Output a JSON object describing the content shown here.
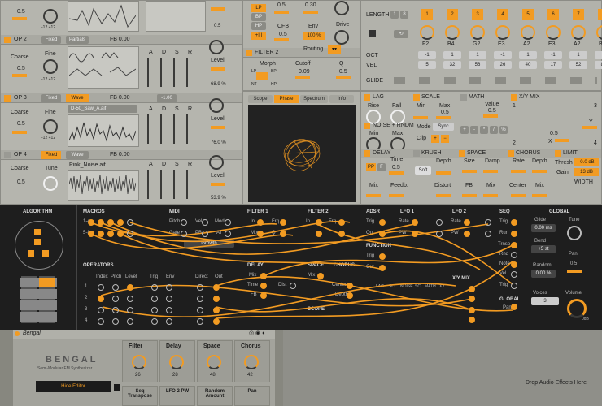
{
  "operators": [
    {
      "name": "",
      "mode": "",
      "waveform": "",
      "values": {
        "top_a": "0.5",
        "fine_range": "-12  +12"
      },
      "level_label": ""
    },
    {
      "name": "OP 2",
      "mode": "Fixed",
      "waveform": "Partials",
      "fb": "FB  0.00",
      "coarse": "Coarse",
      "fine": "Fine",
      "range": "-12  +12",
      "coarse_val": "0.5",
      "level": "Level",
      "level_val": "68.9 %",
      "adsr": [
        "A",
        "D",
        "S",
        "R"
      ]
    },
    {
      "name": "OP 3",
      "mode": "Fixed",
      "waveform": "Wave",
      "fb": "FB  0.00",
      "file": "D-50_Saw_A.aif",
      "coarse": "Coarse",
      "fine": "Fine",
      "range": "-12  +12",
      "coarse_val": "0.5",
      "level": "Level",
      "level_val": "76.0 %",
      "adsr": [
        "A",
        "D",
        "S",
        "R"
      ],
      "loop": "-1.00"
    },
    {
      "name": "OP 4",
      "mode": "Fixed",
      "waveform": "Wave",
      "fb": "FB  0.00",
      "file": "Pink_Noise.aif",
      "coarse": "Coarse",
      "tune": "Tune",
      "coarse_val": "0.5",
      "level": "Level",
      "level_val": "53.9 %",
      "adsr": [
        "A",
        "D",
        "S",
        "R"
      ]
    }
  ],
  "top": {
    "val1": "0.5",
    "val2": "0.30",
    "cfb": "CFB",
    "env": "Env",
    "env_val": "100 %",
    "drive": "Drive",
    "lp": "LP",
    "bp": "BP",
    "hp": "HP",
    "cfb_val": "0.5"
  },
  "filter2": {
    "title": "FILTER 2",
    "morph": "Morph",
    "cutoff": "Cutoff",
    "q": "Q",
    "routing": "Routing",
    "cutoff_val": "0.09",
    "q_val": "0.5",
    "mval": "0.5",
    "lp": "LP",
    "bp": "BP",
    "hp": "HP",
    "nt": "NT"
  },
  "scope": {
    "tabs": [
      "Scope",
      "Phase",
      "Spectrum",
      "Info"
    ],
    "active": "Phase"
  },
  "seq": {
    "length_label": "LENGTH",
    "length_a": "1",
    "length_b": "8",
    "steps": [
      "1",
      "2",
      "3",
      "4",
      "5",
      "6",
      "7",
      "8"
    ],
    "notes": [
      "F2",
      "B4",
      "G2",
      "E3",
      "A2",
      "E3",
      "A2",
      "B1"
    ],
    "oct": "OCT",
    "vel": "VEL",
    "glide": "GLIDE",
    "oct_vals": [
      "-1",
      "1",
      "1",
      "-1",
      "1",
      "-1",
      "1",
      "1"
    ],
    "vel_vals": [
      "5",
      "32",
      "56",
      "26",
      "40",
      "17",
      "52",
      "83"
    ]
  },
  "lag": {
    "title": "LAG",
    "rise": "Rise",
    "fall": "Fall",
    "val": "0.5"
  },
  "scale": {
    "title": "SCALE",
    "min": "Min",
    "max": "Max",
    "mode": "Mode",
    "mode_val": "Sync",
    "clip": "Clip",
    "val": "0.5"
  },
  "noise": {
    "title": "NOISE + RNDM",
    "min": "Min",
    "max": "Max"
  },
  "math": {
    "title": "MATH",
    "value": "Value",
    "val": "0.5",
    "ops": [
      "+",
      "-",
      "*",
      "/",
      "%"
    ]
  },
  "xymix": {
    "title": "X/Y MIX",
    "y": "Y",
    "x": "X",
    "nums": [
      "1",
      "2",
      "3",
      "4"
    ],
    "val": "0.5"
  },
  "delay": {
    "title": "DELAY",
    "time": "Time",
    "mix": "Mix",
    "feedb": "Feedb.",
    "pp": "PP",
    "f": "F",
    "val": "0.5"
  },
  "krush": {
    "title": "KRUSH",
    "depth": "Depth",
    "soft": "Soft",
    "distort": "Distort",
    "val": "0.5"
  },
  "space": {
    "title": "SPACE",
    "size": "Size",
    "damp": "Damp",
    "fb": "FB",
    "mix": "Mix",
    "val": "0.5"
  },
  "chorus": {
    "title": "CHORUS",
    "rate": "Rate",
    "depth": "Depth",
    "center": "Center",
    "mix": "Mix",
    "val": "0.5"
  },
  "limit": {
    "title": "LIMIT",
    "thresh": "Thresh",
    "thresh_val": "-0.0 dB",
    "gain": "Gain",
    "gain_val": "13 dB",
    "width": "WIDTH"
  },
  "bottom": {
    "algorithm": "ALGORITHM",
    "macros": "MACROS",
    "macro_rows": [
      "1-4",
      "5-8"
    ],
    "midi": "MIDI",
    "midi_items": [
      "Pitch",
      "Vel",
      "Mod",
      "Gate",
      "PB",
      "AT"
    ],
    "growth": "Growth",
    "filter1": "FILTER 1",
    "filter2": "FILTER 2",
    "adsr": "ADSR",
    "lfo1": "LFO 1",
    "lfo2": "LFO 2",
    "seq": "SEQ",
    "global": "GLOBAL",
    "f_in": "In",
    "f_frq": "Frq",
    "f_mix": "Mix",
    "f_q": "Q",
    "adsr_trig": "Trig",
    "adsr_out": "Out",
    "lfo_rate": "Rate",
    "lfo_pw": "PW",
    "lfo_out": "Out",
    "seq_items": [
      "Trig",
      "Run",
      "Trnsp",
      "Rnd",
      "Note",
      "Vel",
      "Trig"
    ],
    "function": "FUNCTION",
    "xymix": "X/Y MIX",
    "global2": "GLOBAL",
    "pan": "Pan",
    "operators": "OPERATORS",
    "op_cols": [
      "Index",
      "Pitch",
      "Level",
      "Trig",
      "Env",
      "Direct",
      "Out"
    ],
    "op_rows": [
      "1",
      "2",
      "3",
      "4"
    ],
    "delay": "DELAY",
    "space": "SPACE",
    "chorus": "CHORUS",
    "scope": "SCOPE",
    "lag": "LAG",
    "noise": "NOISE",
    "d_mix": "Mix",
    "d_time": "Time",
    "d_fb": "FB",
    "s_mix": "Mix",
    "c_center": "Center",
    "c_depth": "Depth",
    "s_dist": "Dist",
    "func_row": [
      "LAG",
      "SCL",
      "NOISE",
      "SC",
      "MATH",
      "XY"
    ],
    "glide": "Glide",
    "glide_val": "0.00 ms",
    "tune": "Tune",
    "bend": "Bend",
    "bend_val": "+5 st",
    "random": "Random",
    "random_val": "0.00 %",
    "panl": "Pan",
    "pan_val": "0.5",
    "voices": "Voices",
    "voices_val": "3",
    "volume": "Volume",
    "volume_val": "0dB"
  },
  "device": {
    "title": "Bengal",
    "logo": "BENGAL",
    "subtitle": "Semi-Modular FM Synthesizer",
    "hide": "Hide Editor",
    "macros": [
      {
        "name": "Filter",
        "val": "26"
      },
      {
        "name": "Delay",
        "val": "28"
      },
      {
        "name": "Space",
        "val": "48"
      },
      {
        "name": "Chorus",
        "val": "42"
      }
    ],
    "macros2": [
      "Seq Transpose",
      "LFO 2 PW",
      "Random Amount",
      "Pan"
    ],
    "drop": "Drop Audio Effects Here"
  },
  "colors": {
    "accent": "#f29b22",
    "panel": "#b2b2ab",
    "dark": "#1e1e1e",
    "bg": "#9a9a94"
  }
}
